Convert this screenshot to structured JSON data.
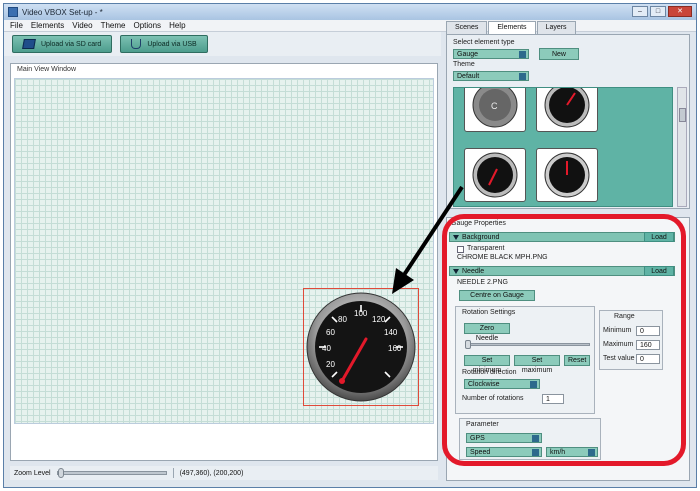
{
  "window": {
    "title": "Video VBOX Set-up - *"
  },
  "menu": [
    "File",
    "Elements",
    "Video",
    "Theme",
    "Options",
    "Help"
  ],
  "toolbar": {
    "sd_label": "Upload via SD card",
    "usb_label": "Upload via USB"
  },
  "mainview": {
    "label": "Main View Window"
  },
  "status": {
    "zoom_label": "Zoom Level",
    "coords": "(497,360), (200,200)"
  },
  "tabs": [
    "Scenes",
    "Elements",
    "Layers"
  ],
  "elements": {
    "type_label": "Select element type",
    "type_value": "Gauge",
    "new_label": "New",
    "theme_label": "Theme",
    "theme_value": "Default"
  },
  "props": {
    "title": "Gauge Properties",
    "background": {
      "label": "Background",
      "load": "Load",
      "transparent": "Transparent",
      "file": "CHROME BLACK MPH.PNG"
    },
    "needle": {
      "label": "Needle",
      "load": "Load",
      "file": "NEEDLE 2.PNG",
      "centre": "Centre on Gauge"
    },
    "rotation": {
      "title": "Rotation Settings",
      "zero": "Zero Needle",
      "set_min": "Set minimum",
      "set_max": "Set maximum",
      "reset": "Reset",
      "dir_label": "Rotation direction",
      "dir_value": "Clockwise",
      "num_label": "Number of rotations",
      "num_value": "1"
    },
    "range": {
      "title": "Range",
      "min_label": "Minimum",
      "min_value": "0",
      "max_label": "Maximum",
      "max_value": "160",
      "test_label": "Test value",
      "test_value": "0"
    },
    "parameter": {
      "title": "Parameter",
      "source": "GPS",
      "channel": "Speed",
      "unit": "km/h"
    }
  },
  "gauge": {
    "ticks": [
      "20",
      "40",
      "60",
      "80",
      "100",
      "120",
      "140",
      "160"
    ]
  },
  "colors": {
    "accent": "#5fb3a5",
    "highlight": "#e3192a"
  }
}
